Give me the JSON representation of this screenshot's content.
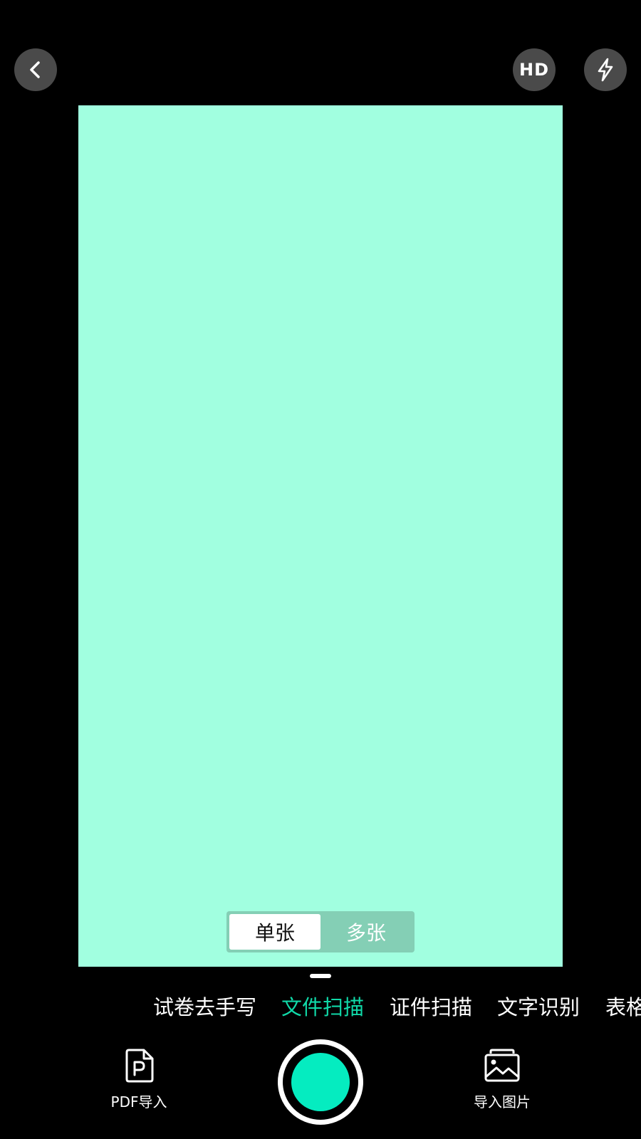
{
  "top_bar": {
    "back_icon": "chevron-left-icon",
    "hd_label": "HD",
    "flash_icon": "flash-icon"
  },
  "viewfinder": {
    "color": "#a1ffe0"
  },
  "mode_toggle": {
    "single_label": "单张",
    "multi_label": "多张",
    "selected": "单张"
  },
  "function_tabs": [
    {
      "label": "试卷去手写",
      "active": false
    },
    {
      "label": "文件扫描",
      "active": true
    },
    {
      "label": "证件扫描",
      "active": false
    },
    {
      "label": "文字识别",
      "active": false
    },
    {
      "label": "表格",
      "active": false
    }
  ],
  "bottom_bar": {
    "pdf_import_label": "PDF导入",
    "pdf_import_icon": "pdf-file-icon",
    "image_import_label": "导入图片",
    "image_import_icon": "image-gallery-icon",
    "shutter_icon": "shutter-button"
  },
  "colors": {
    "accent": "#10d9a8",
    "shutter": "#05ecc0",
    "toggle_bg": "#84cfb5"
  }
}
